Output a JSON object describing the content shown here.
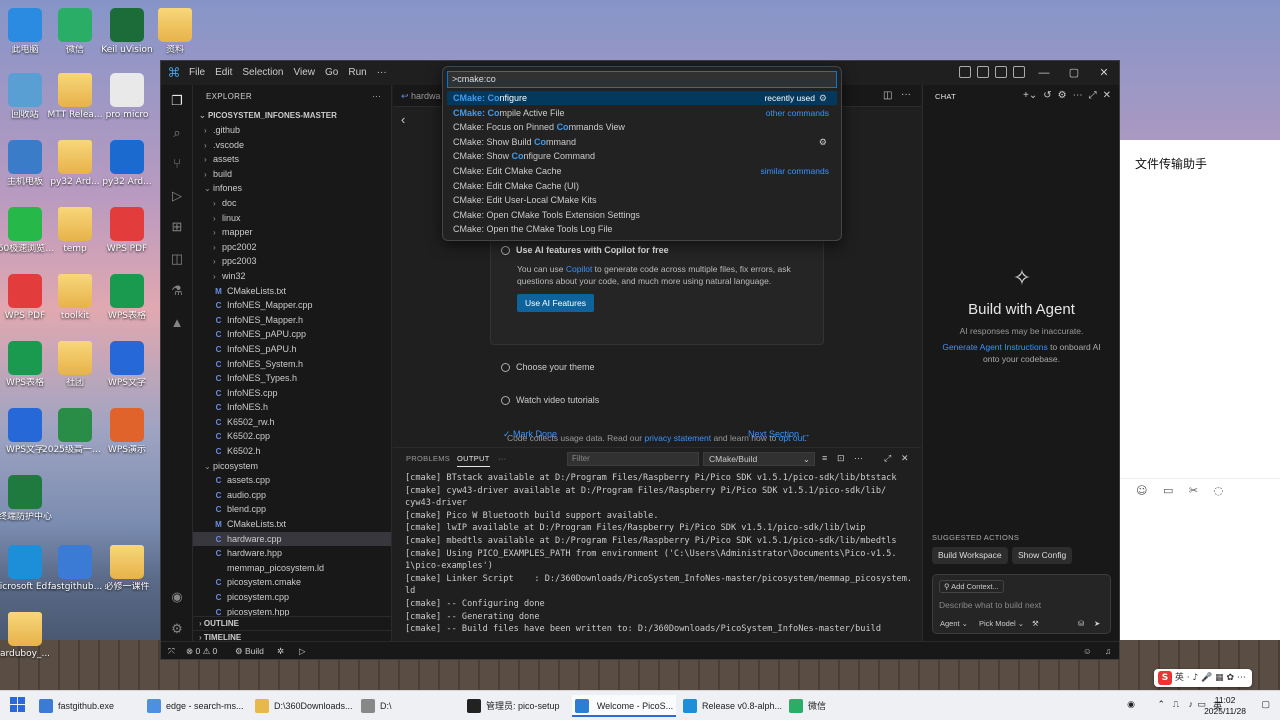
{
  "desktop": {
    "icons": [
      {
        "label": "此电脑",
        "color": "#2a8be0"
      },
      {
        "label": "微信",
        "color": "#2aae67"
      },
      {
        "label": "Keil uVision",
        "color": "#1c6c3a"
      },
      {
        "label": "资料",
        "color": "folder"
      },
      {
        "label": "回收站",
        "color": "#5a9fd4"
      },
      {
        "label": "MTT Relea...",
        "color": "folder"
      },
      {
        "label": "pro micro",
        "color": "#e9e9e9"
      },
      {
        "label": "主机电板",
        "color": "#3a7cc8"
      },
      {
        "label": "py32 Ard...",
        "color": "folder"
      },
      {
        "label": "py32 Ard...",
        "color": "#1a6ad0"
      },
      {
        "label": "360极速浏览器X",
        "color": "#27b84a"
      },
      {
        "label": "temp",
        "color": "folder"
      },
      {
        "label": "WPS PDF",
        "color": "#e23c3c"
      },
      {
        "label": "WPS PDF",
        "color": "#e23c3c"
      },
      {
        "label": "toolkit",
        "color": "folder"
      },
      {
        "label": "WPS表格",
        "color": "#1a9a4e"
      },
      {
        "label": "WPS表格",
        "color": "#1a9a4e"
      },
      {
        "label": "社团",
        "color": "folder"
      },
      {
        "label": "WPS文字",
        "color": "#2668d8"
      },
      {
        "label": "WPS文字",
        "color": "#2668d8"
      },
      {
        "label": "2025级高一上学期日课表",
        "color": "#2a8d47"
      },
      {
        "label": "WPS演示",
        "color": "#e0632b"
      },
      {
        "label": "终端防护中心",
        "color": "#1e7a3e"
      },
      {
        "label": "Microsoft Edge",
        "color": "#1d8fd8"
      },
      {
        "label": "fastgithub...",
        "color": "#3b7bd6"
      },
      {
        "label": "必修一课件",
        "color": "folder"
      },
      {
        "label": "arduboy_...",
        "color": "folder"
      }
    ]
  },
  "window": {
    "menu": [
      "File",
      "Edit",
      "Selection",
      "View",
      "Go",
      "Run",
      "···"
    ],
    "controls": [
      "—",
      "▢",
      "✕"
    ]
  },
  "explorer": {
    "header": "EXPLORER",
    "root": "PICOSYSTEM_INFONES-MASTER",
    "items": [
      {
        "name": ".github",
        "type": "folder",
        "depth": 1,
        "open": false
      },
      {
        "name": ".vscode",
        "type": "folder",
        "depth": 1,
        "open": false
      },
      {
        "name": "assets",
        "type": "folder",
        "depth": 1,
        "open": false
      },
      {
        "name": "build",
        "type": "folder",
        "depth": 1,
        "open": false
      },
      {
        "name": "infones",
        "type": "folder",
        "depth": 1,
        "open": true
      },
      {
        "name": "doc",
        "type": "folder",
        "depth": 2,
        "open": false
      },
      {
        "name": "linux",
        "type": "folder",
        "depth": 2,
        "open": false
      },
      {
        "name": "mapper",
        "type": "folder",
        "depth": 2,
        "open": false
      },
      {
        "name": "ppc2002",
        "type": "folder",
        "depth": 2,
        "open": false
      },
      {
        "name": "ppc2003",
        "type": "folder",
        "depth": 2,
        "open": false
      },
      {
        "name": "win32",
        "type": "folder",
        "depth": 2,
        "open": false
      },
      {
        "name": "CMakeLists.txt",
        "type": "m",
        "depth": 2
      },
      {
        "name": "InfoNES_Mapper.cpp",
        "type": "c",
        "depth": 2
      },
      {
        "name": "InfoNES_Mapper.h",
        "type": "c",
        "depth": 2
      },
      {
        "name": "InfoNES_pAPU.cpp",
        "type": "c",
        "depth": 2
      },
      {
        "name": "InfoNES_pAPU.h",
        "type": "c",
        "depth": 2
      },
      {
        "name": "InfoNES_System.h",
        "type": "c",
        "depth": 2
      },
      {
        "name": "InfoNES_Types.h",
        "type": "c",
        "depth": 2
      },
      {
        "name": "InfoNES.cpp",
        "type": "c",
        "depth": 2
      },
      {
        "name": "InfoNES.h",
        "type": "c",
        "depth": 2
      },
      {
        "name": "K6502_rw.h",
        "type": "c",
        "depth": 2
      },
      {
        "name": "K6502.cpp",
        "type": "c",
        "depth": 2
      },
      {
        "name": "K6502.h",
        "type": "c",
        "depth": 2
      },
      {
        "name": "picosystem",
        "type": "folder",
        "depth": 1,
        "open": true
      },
      {
        "name": "assets.cpp",
        "type": "c",
        "depth": 2
      },
      {
        "name": "audio.cpp",
        "type": "c",
        "depth": 2
      },
      {
        "name": "blend.cpp",
        "type": "c",
        "depth": 2
      },
      {
        "name": "CMakeLists.txt",
        "type": "m",
        "depth": 2
      },
      {
        "name": "hardware.cpp",
        "type": "c",
        "depth": 2,
        "selected": true
      },
      {
        "name": "hardware.hpp",
        "type": "c",
        "depth": 2
      },
      {
        "name": "memmap_picosystem.ld",
        "type": "ld",
        "depth": 2
      },
      {
        "name": "picosystem.cmake",
        "type": "c",
        "depth": 2
      },
      {
        "name": "picosystem.cpp",
        "type": "c",
        "depth": 2
      },
      {
        "name": "picosystem.hpp",
        "type": "c",
        "depth": 2
      }
    ],
    "outline": "OUTLINE",
    "timeline": "TIMELINE"
  },
  "editor": {
    "tab_label": "hardwa",
    "copilot_title": "Use AI features with Copilot for free",
    "copilot_text_pre": "You can use ",
    "copilot_link": "Copilot",
    "copilot_text_post": " to generate code across multiple files, fix errors, ask questions about your code, and much more using natural language.",
    "copilot_button": "Use AI Features",
    "step_theme": "Choose your theme",
    "step_video": "Watch video tutorials",
    "mark_done": "Mark Done",
    "next_section": "Next Section →",
    "footer_pre": "Code collects usage data. Read our ",
    "footer_privacy": "privacy statement",
    "footer_mid": " and learn how to ",
    "footer_optout": "opt out",
    "footer_end": "."
  },
  "palette": {
    "input": ">cmake:co",
    "items": [
      {
        "pre": "CMake: ",
        "hl": "Co",
        "rest": "nfigure",
        "right": "recently used",
        "gear": true,
        "active": true
      },
      {
        "pre": "CMake: ",
        "hl": "Co",
        "rest": "mpile Active File",
        "right": "other commands",
        "link": true
      },
      {
        "pre": "CMake: Focus on Pinned ",
        "hl": "Co",
        "rest": "mmands View",
        "right": ""
      },
      {
        "pre": "CMake: Show Build ",
        "hl": "Co",
        "rest": "mmand",
        "right": "",
        "gear": true
      },
      {
        "pre": "CMake: Show ",
        "hl": "Co",
        "rest": "nfigure Command",
        "right": ""
      },
      {
        "pre": "CMake: Edit CMake Cache",
        "hl": "",
        "rest": "",
        "right": "similar commands",
        "link": true
      },
      {
        "pre": "CMake: Edit CMake Cache (UI)",
        "hl": "",
        "rest": "",
        "right": ""
      },
      {
        "pre": "CMake: Edit User-Local CMake Kits",
        "hl": "",
        "rest": "",
        "right": ""
      },
      {
        "pre": "CMake: Open CMake Tools Extension Settings",
        "hl": "",
        "rest": "",
        "right": ""
      },
      {
        "pre": "CMake: Open the CMake Tools Log File",
        "hl": "",
        "rest": "",
        "right": ""
      }
    ]
  },
  "panel": {
    "tabs": [
      "PROBLEMS",
      "OUTPUT",
      "···"
    ],
    "filter_placeholder": "Filter",
    "channel": "CMake/Build",
    "lines": [
      "[cmake] BTstack available at D:/Program Files/Raspberry Pi/Pico SDK v1.5.1/pico-sdk/lib/btstack",
      "[cmake] cyw43-driver available at D:/Program Files/Raspberry Pi/Pico SDK v1.5.1/pico-sdk/lib/",
      "cyw43-driver",
      "[cmake] Pico W Bluetooth build support available.",
      "[cmake] lwIP available at D:/Program Files/Raspberry Pi/Pico SDK v1.5.1/pico-sdk/lib/lwip",
      "[cmake] mbedtls available at D:/Program Files/Raspberry Pi/Pico SDK v1.5.1/pico-sdk/lib/mbedtls",
      "[cmake] Using PICO_EXAMPLES_PATH from environment ('C:\\Users\\Administrator\\Documents\\Pico-v1.5.",
      "1\\pico-examples')",
      "[cmake] Linker Script    : D:/360Downloads/PicoSystem_InfoNes-master/picosystem/memmap_picosystem.",
      "ld",
      "[cmake] -- Configuring done",
      "[cmake] -- Generating done",
      "[cmake] -- Build files have been written to: D:/360Downloads/PicoSystem_InfoNes-master/build"
    ]
  },
  "chat": {
    "header": "CHAT",
    "title": "Build with Agent",
    "note": "AI responses may be inaccurate.",
    "desc_link": "Generate Agent Instructions",
    "desc_rest": " to onboard AI onto your codebase.",
    "suggested": "SUGGESTED ACTIONS",
    "btn1": "Build Workspace",
    "btn2": "Show Config",
    "add_context": "Add Context...",
    "placeholder": "Describe what to build next",
    "mode": "Agent ⌄",
    "model": "Pick Model ⌄"
  },
  "status": {
    "errors": "⊗ 0 ⚠ 0",
    "build": "⚙ Build"
  },
  "wechat_panel": {
    "title": "文件传输助手",
    "toolbar": "☺ ▭ ✂ ◌"
  },
  "taskbar": {
    "items": [
      {
        "label": "fastgithub.exe",
        "color": "#3b7bd6"
      },
      {
        "label": "edge - search-ms...",
        "color": "#4d8fe0"
      },
      {
        "label": "D:\\360Downloads...",
        "color": "#e9b84a"
      },
      {
        "label": "D:\\",
        "color": "#888"
      },
      {
        "label": "管理员: pico-setup",
        "color": "#222"
      },
      {
        "label": "Welcome - PicoS...",
        "color": "#2a7fd4",
        "active": true
      },
      {
        "label": "Release v0.8-alph...",
        "color": "#1d8fd8"
      },
      {
        "label": "微信",
        "color": "#2aae67"
      }
    ],
    "time": "11:02",
    "date": "2025/11/28",
    "lang": "英",
    "ime": "英 · ♪ 🎤 ▦ ✿ ⋯"
  }
}
